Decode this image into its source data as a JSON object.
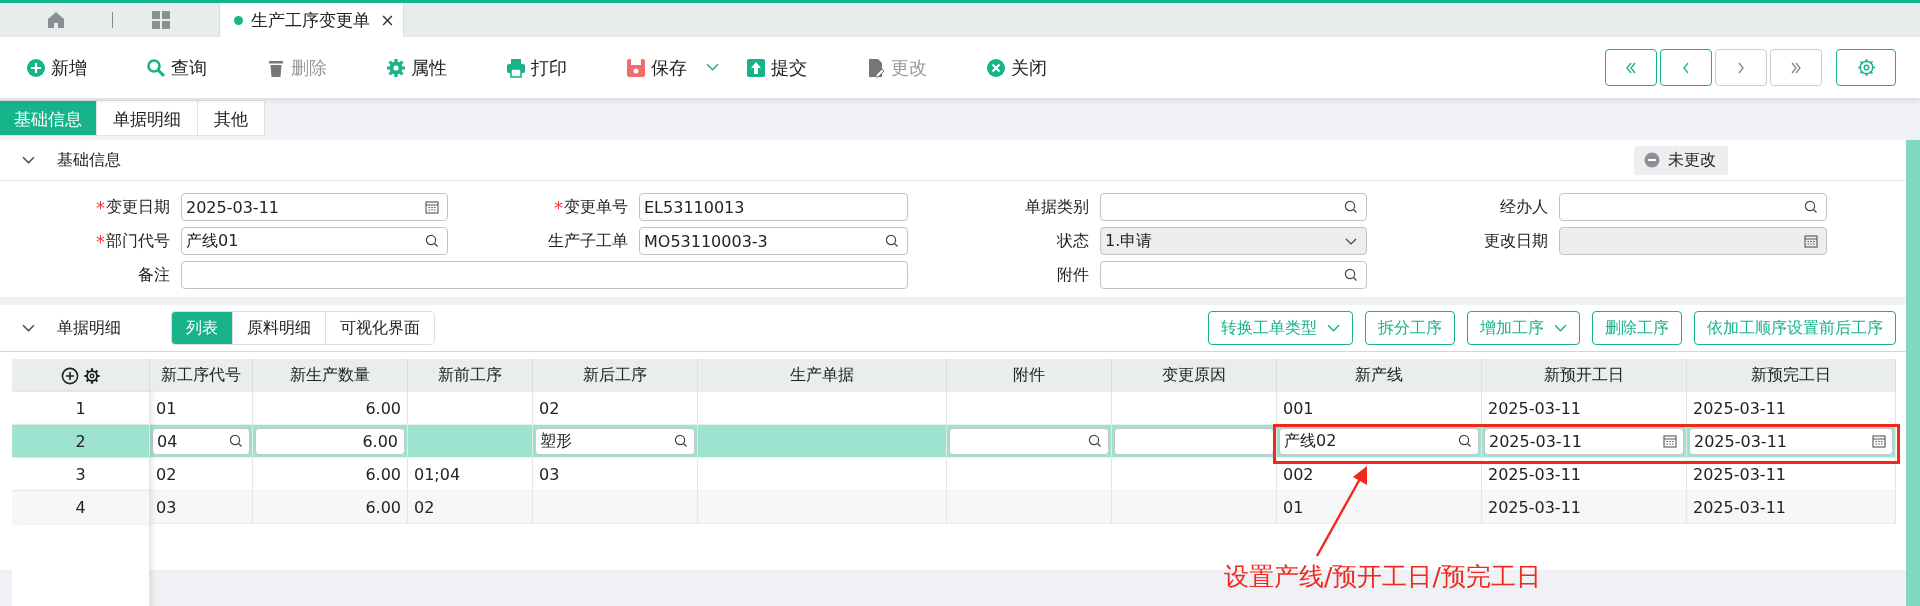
{
  "doc_tabs": [
    {
      "label": "生产工序变更单",
      "selected": true,
      "closable": true
    }
  ],
  "toolbar": [
    {
      "kind": "add",
      "label": "新增",
      "disabled": false,
      "dropdown": false
    },
    {
      "kind": "query",
      "label": "查询",
      "disabled": false,
      "dropdown": false
    },
    {
      "kind": "delete",
      "label": "删除",
      "disabled": true,
      "dropdown": false
    },
    {
      "kind": "properties",
      "label": "属性",
      "disabled": false,
      "dropdown": false
    },
    {
      "kind": "print",
      "label": "打印",
      "disabled": false,
      "dropdown": false
    },
    {
      "kind": "save",
      "label": "保存",
      "disabled": false,
      "dropdown": true
    },
    {
      "kind": "submit",
      "label": "提交",
      "disabled": false,
      "dropdown": false
    },
    {
      "kind": "modify",
      "label": "更改",
      "disabled": true,
      "dropdown": false
    },
    {
      "kind": "close",
      "label": "关闭",
      "disabled": false,
      "dropdown": false
    }
  ],
  "nav_buttons": [
    {
      "kind": "first",
      "disabled": false
    },
    {
      "kind": "prev",
      "disabled": false
    },
    {
      "kind": "next",
      "disabled": true
    },
    {
      "kind": "last",
      "disabled": true
    }
  ],
  "form_tabs": [
    {
      "label": "基础信息",
      "selected": true
    },
    {
      "label": "单据明细",
      "selected": false
    },
    {
      "label": "其他",
      "selected": false
    }
  ],
  "basic_info": {
    "title": "基础信息",
    "expanded": true,
    "status": "未更改",
    "fields": [
      {
        "label": "变更日期",
        "mark": "*",
        "kind": "date",
        "value": "2025-03-11",
        "disabled": false
      },
      {
        "label": "变更单号",
        "mark": "*",
        "kind": "text",
        "value": "EL53110013",
        "disabled": false
      },
      {
        "label": "单据类别",
        "kind": "search",
        "disabled": false
      },
      {
        "label": "经办人",
        "kind": "search",
        "disabled": false
      },
      {
        "label": "部门代号",
        "mark": "*",
        "kind": "search",
        "value": "产线01",
        "disabled": false
      },
      {
        "label": "生产子工单",
        "kind": "search",
        "value": "MO53110003-3",
        "disabled": false
      },
      {
        "label": "状态",
        "kind": "select",
        "value": "1.申请",
        "disabled": true
      },
      {
        "label": "更改日期",
        "kind": "date",
        "disabled": true
      },
      {
        "label": "备注",
        "kind": "note",
        "disabled": false
      },
      {
        "label": "附件",
        "kind": "search",
        "disabled": false
      }
    ]
  },
  "details": {
    "title": "单据明细",
    "expanded": true,
    "view_tabs": [
      {
        "label": "列表",
        "selected": true
      },
      {
        "label": "原料明细",
        "selected": false
      },
      {
        "label": "可视化界面",
        "selected": false
      }
    ],
    "actions": [
      {
        "label": "转换工单类型",
        "dropdown": true
      },
      {
        "label": "拆分工序",
        "dropdown": false
      },
      {
        "label": "增加工序",
        "dropdown": true
      },
      {
        "label": "删除工序",
        "dropdown": false
      },
      {
        "label": "依加工顺序设置前后工序",
        "dropdown": false
      }
    ],
    "table": {
      "columns": [
        {
          "label": "新工序代号",
          "kind": "search"
        },
        {
          "label": "新生产数量",
          "kind": "number"
        },
        {
          "label": "新前工序",
          "kind": "none"
        },
        {
          "label": "新后工序",
          "kind": "search"
        },
        {
          "label": "生产单据",
          "kind": "none"
        },
        {
          "label": "附件",
          "kind": "search"
        },
        {
          "label": "变更原因",
          "kind": "text"
        },
        {
          "label": "新产线",
          "kind": "search"
        },
        {
          "label": "新预开工日",
          "kind": "date"
        },
        {
          "label": "新预完工日",
          "kind": "date"
        }
      ],
      "rows": [
        {
          "no": "1",
          "selected": false,
          "cells": [
            "01",
            "6.00",
            null,
            "02",
            null,
            null,
            null,
            "001",
            "2025-03-11",
            "2025-03-11"
          ]
        },
        {
          "no": "2",
          "selected": true,
          "cells": [
            "04",
            "6.00",
            null,
            "塑形",
            null,
            null,
            null,
            "产线02",
            "2025-03-11",
            "2025-03-11"
          ]
        },
        {
          "no": "3",
          "selected": false,
          "cells": [
            "02",
            "6.00",
            "01;04",
            "03",
            null,
            null,
            null,
            "002",
            "2025-03-11",
            "2025-03-11"
          ]
        },
        {
          "no": "4",
          "selected": false,
          "cells": [
            "03",
            "6.00",
            "02",
            null,
            null,
            null,
            null,
            "01",
            "2025-03-11",
            "2025-03-11"
          ]
        }
      ]
    }
  },
  "annotation": {
    "text": "设置产线/预开工日/预完工日"
  }
}
